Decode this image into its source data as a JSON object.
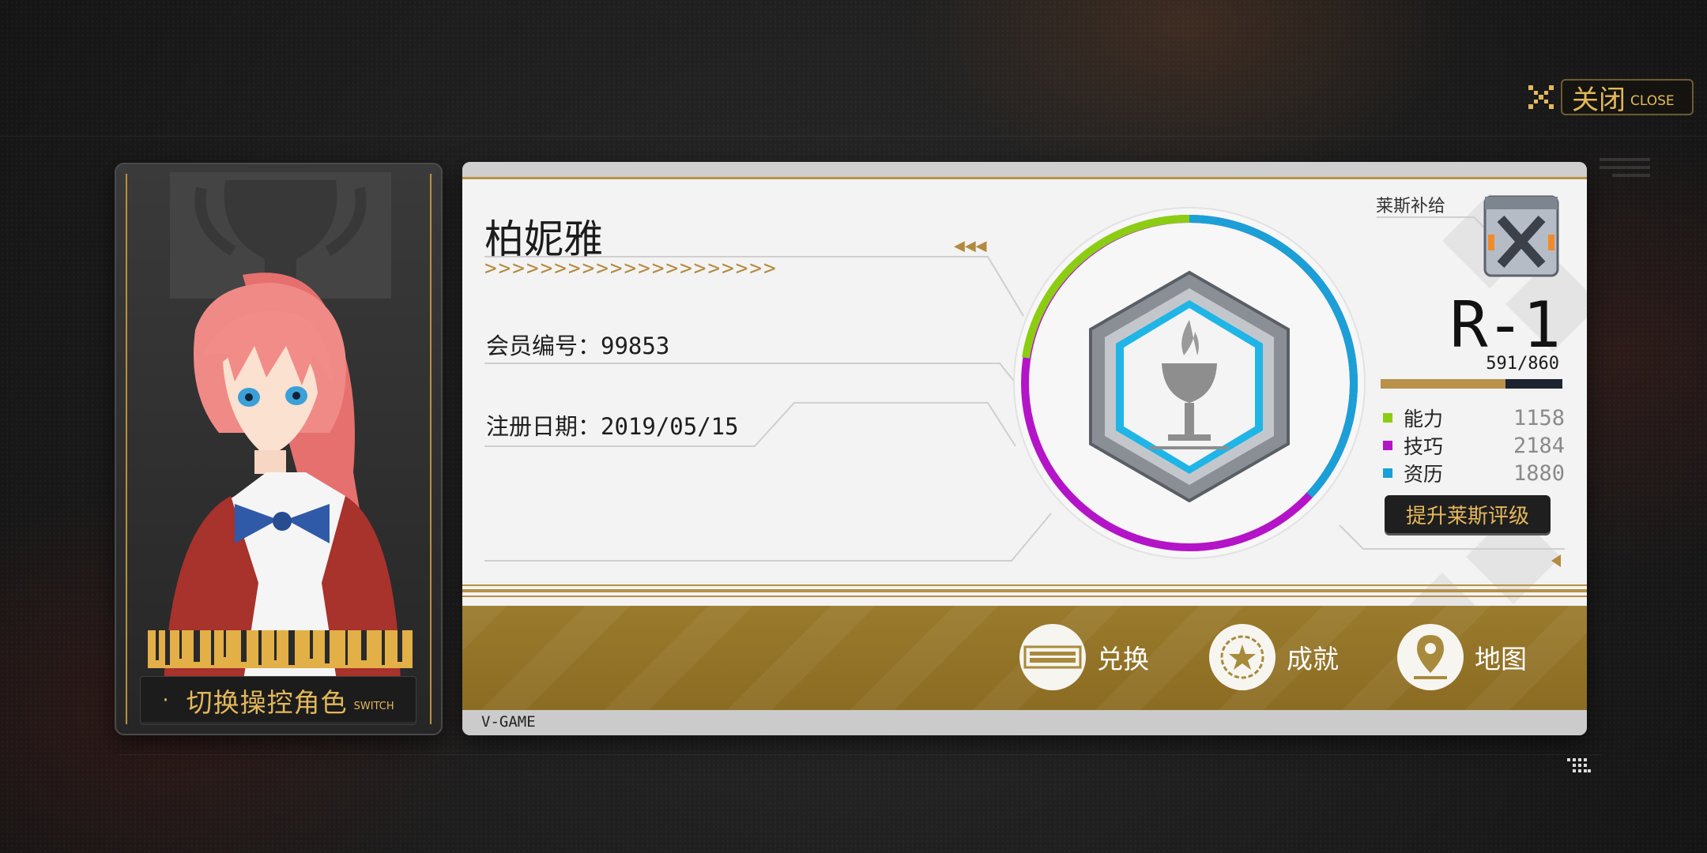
{
  "close": {
    "label_cn": "关闭",
    "label_en": "CLOSE",
    "icon": "close-x-icon"
  },
  "character_card": {
    "switch_label_cn": "切换操控角色",
    "switch_label_en": "SWITCH",
    "portrait": "character-portrait-pink-hair"
  },
  "profile": {
    "name": "柏妮雅",
    "member_id": "会员编号：99853",
    "register_date": "注册日期：2019/05/15"
  },
  "rank": {
    "supply_label": "莱斯补给",
    "rank_code": "R-1",
    "progress_text": "591/860",
    "progress_current": 591,
    "progress_max": 860,
    "upgrade_label": "提升莱斯评级",
    "stats": [
      {
        "label": "能力",
        "value": "1158",
        "color": "#8ccd14"
      },
      {
        "label": "技巧",
        "value": "2184",
        "color": "#b414c8"
      },
      {
        "label": "资历",
        "value": "1880",
        "color": "#1aa0d6"
      }
    ]
  },
  "actions": [
    {
      "label": "兑换",
      "icon": "ticket-icon"
    },
    {
      "label": "成就",
      "icon": "laurel-star-icon"
    },
    {
      "label": "地图",
      "icon": "map-pin-icon"
    }
  ],
  "footer": {
    "brand": "V-GAME"
  },
  "colors": {
    "accent_gold": "#e3b75a",
    "band_gold": "#9a7a2c"
  }
}
